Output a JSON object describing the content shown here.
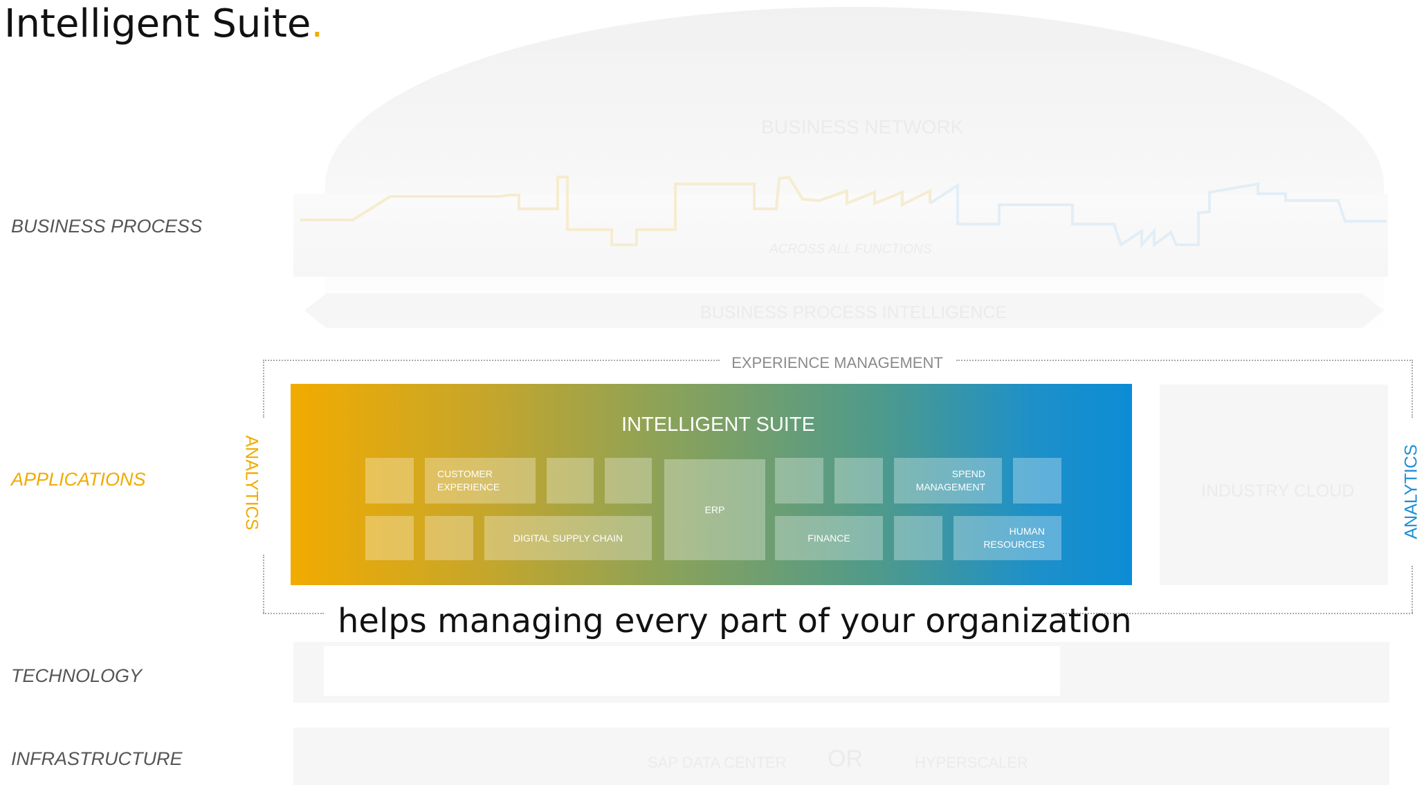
{
  "title": {
    "text": "Intelligent Suite",
    "accent": "."
  },
  "layers": {
    "business_process": "BUSINESS PROCESS",
    "applications": "APPLICATIONS",
    "technology": "TECHNOLOGY",
    "infrastructure": "INFRASTRUCTURE"
  },
  "background": {
    "business_network": "BUSINESS NETWORK",
    "across_all_functions": "ACROSS ALL FUNCTIONS",
    "business_process_intelligence": "BUSINESS PROCESS INTELLIGENCE",
    "industry_cloud": "INDUSTRY CLOUD",
    "sap_data_center": "SAP DATA CENTER",
    "or": "OR",
    "hyperscaler": "HYPERSCALER"
  },
  "experience_management": "EXPERIENCE MANAGEMENT",
  "analytics_left": "ANALYTICS",
  "analytics_right": "ANALYTICS",
  "suite": {
    "title": "INTELLIGENT SUITE",
    "customer_experience": "CUSTOMER\nEXPERIENCE",
    "digital_supply_chain": "DIGITAL SUPPLY CHAIN",
    "erp": "ERP",
    "finance": "FINANCE",
    "spend_management": "SPEND\nMANAGEMENT",
    "human_resources": "HUMAN\nRESOURCES"
  },
  "caption": "helps managing every part of your organization",
  "colors": {
    "accent": "#f0ab00",
    "blue": "#0c8cd6",
    "text": "#111111",
    "muted": "#555555"
  }
}
